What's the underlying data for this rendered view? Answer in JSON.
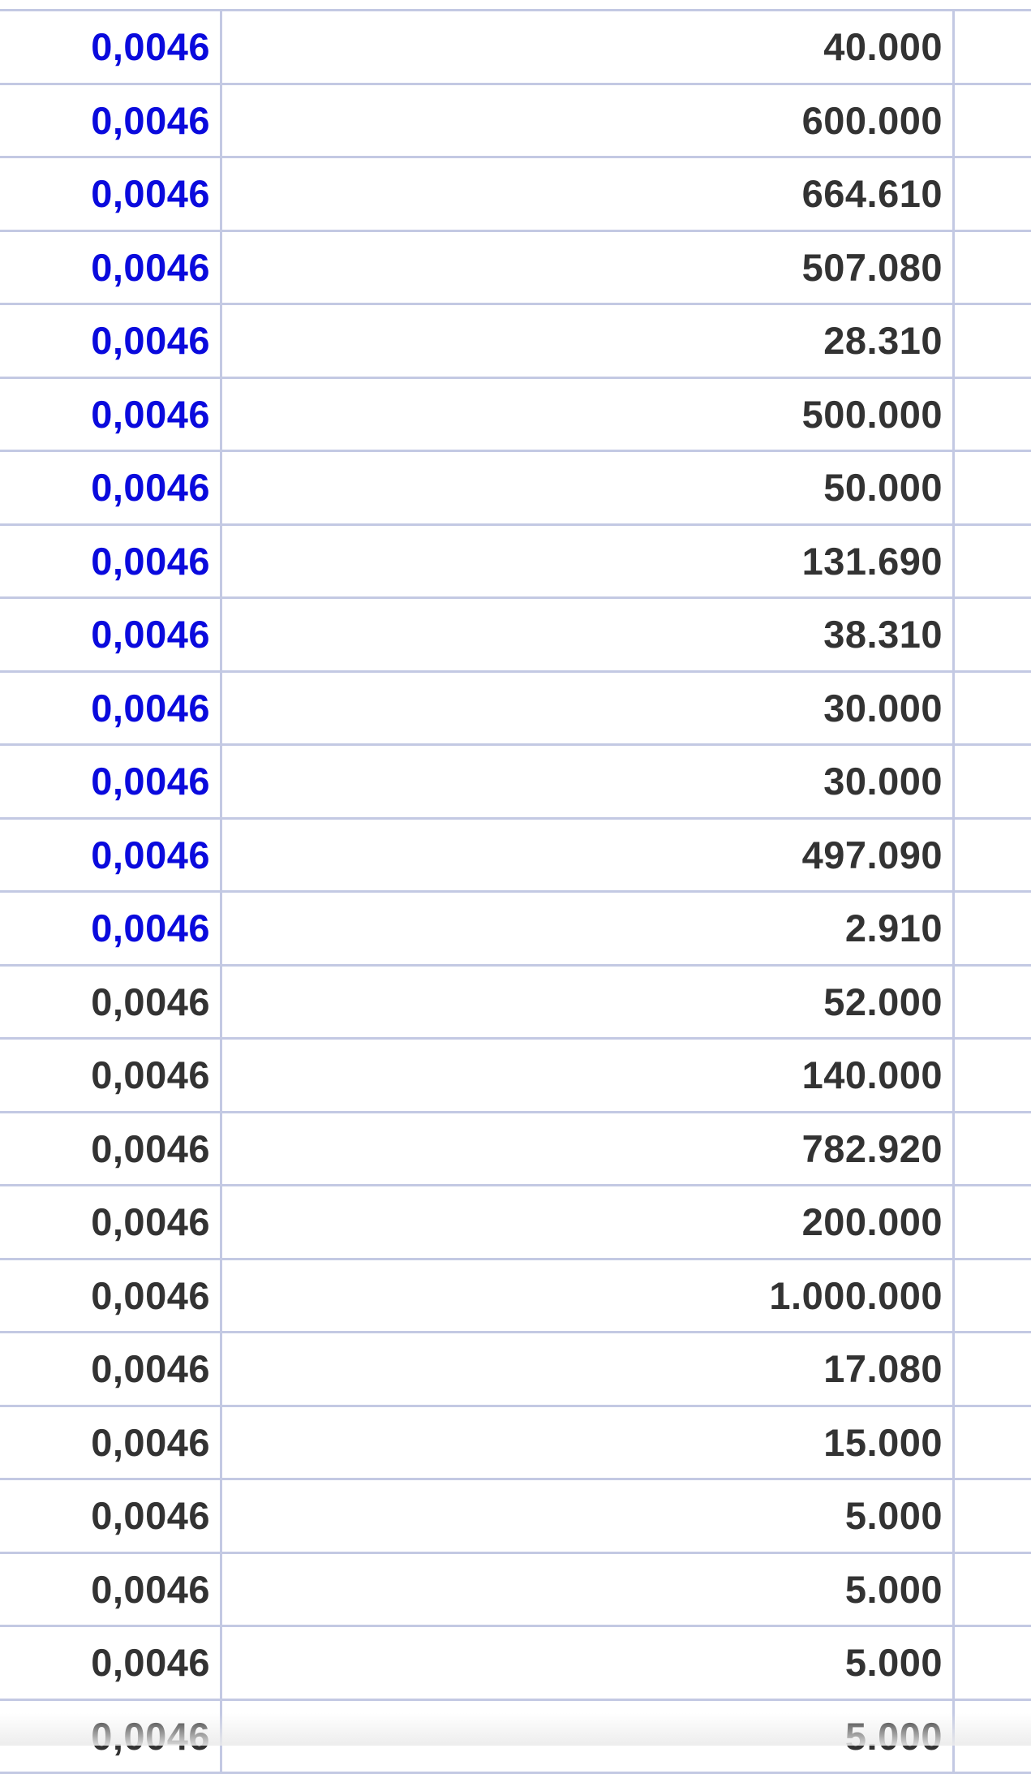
{
  "table": {
    "rows": [
      {
        "price": "0,0046",
        "qty": "40.000",
        "link": true
      },
      {
        "price": "0,0046",
        "qty": "600.000",
        "link": true
      },
      {
        "price": "0,0046",
        "qty": "664.610",
        "link": true
      },
      {
        "price": "0,0046",
        "qty": "507.080",
        "link": true
      },
      {
        "price": "0,0046",
        "qty": "28.310",
        "link": true
      },
      {
        "price": "0,0046",
        "qty": "500.000",
        "link": true
      },
      {
        "price": "0,0046",
        "qty": "50.000",
        "link": true
      },
      {
        "price": "0,0046",
        "qty": "131.690",
        "link": true
      },
      {
        "price": "0,0046",
        "qty": "38.310",
        "link": true
      },
      {
        "price": "0,0046",
        "qty": "30.000",
        "link": true
      },
      {
        "price": "0,0046",
        "qty": "30.000",
        "link": true
      },
      {
        "price": "0,0046",
        "qty": "497.090",
        "link": true
      },
      {
        "price": "0,0046",
        "qty": "2.910",
        "link": true
      },
      {
        "price": "0,0046",
        "qty": "52.000",
        "link": false
      },
      {
        "price": "0,0046",
        "qty": "140.000",
        "link": false
      },
      {
        "price": "0,0046",
        "qty": "782.920",
        "link": false
      },
      {
        "price": "0,0046",
        "qty": "200.000",
        "link": false
      },
      {
        "price": "0,0046",
        "qty": "1.000.000",
        "link": false
      },
      {
        "price": "0,0046",
        "qty": "17.080",
        "link": false
      },
      {
        "price": "0,0046",
        "qty": "15.000",
        "link": false
      },
      {
        "price": "0,0046",
        "qty": "5.000",
        "link": false
      },
      {
        "price": "0,0046",
        "qty": "5.000",
        "link": false
      },
      {
        "price": "0,0046",
        "qty": "5.000",
        "link": false
      },
      {
        "price": "0,0046",
        "qty": "5.000",
        "link": false
      }
    ]
  },
  "colors": {
    "link": "#0a0add",
    "text": "#333333",
    "border": "#c3c9e3"
  }
}
